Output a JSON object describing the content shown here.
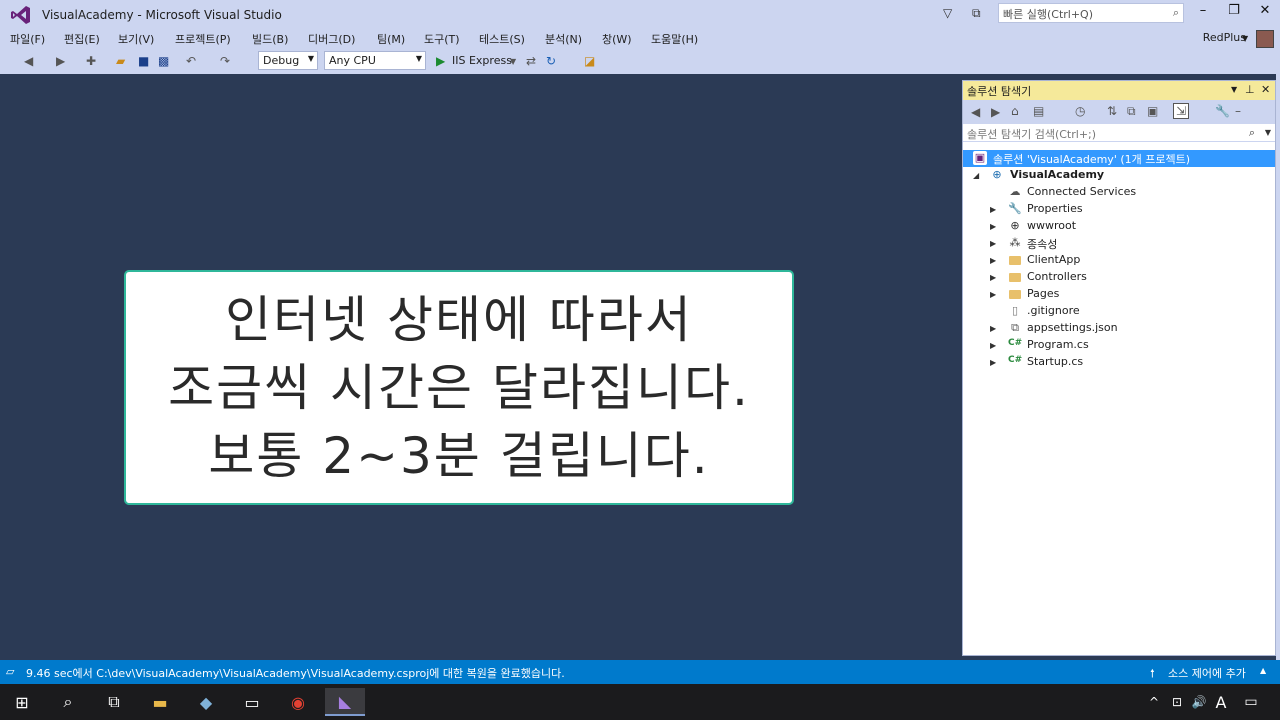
{
  "window": {
    "title": "VisualAcademy - Microsoft Visual Studio"
  },
  "quick_launch": {
    "placeholder": "빠른 실행(Ctrl+Q)"
  },
  "menu": [
    "파일(F)",
    "편집(E)",
    "보기(V)",
    "프로젝트(P)",
    "빌드(B)",
    "디버그(D)",
    "팀(M)",
    "도구(T)",
    "테스트(S)",
    "분석(N)",
    "창(W)",
    "도움말(H)"
  ],
  "user": {
    "name": "RedPlus"
  },
  "toolbar": {
    "config": "Debug",
    "platform": "Any CPU",
    "run_label": "IIS Express"
  },
  "overlay": {
    "lines": [
      "인터넷 상태에 따라서",
      "조금씩 시간은 달라집니다.",
      "보통 2~3분 걸립니다."
    ]
  },
  "solution_explorer": {
    "title": "솔루션 탐색기",
    "search_placeholder": "솔루션 탐색기 검색(Ctrl+;)",
    "solution": "솔루션 'VisualAcademy' (1개 프로젝트)",
    "project": "VisualAcademy",
    "items": [
      {
        "label": "Connected Services",
        "icon": "connected-services-icon",
        "expandable": false
      },
      {
        "label": "Properties",
        "icon": "wrench-icon",
        "expandable": true
      },
      {
        "label": "wwwroot",
        "icon": "globe-icon",
        "expandable": true
      },
      {
        "label": "종속성",
        "icon": "dependencies-icon",
        "expandable": true
      },
      {
        "label": "ClientApp",
        "icon": "folder-icon",
        "expandable": true
      },
      {
        "label": "Controllers",
        "icon": "folder-icon",
        "expandable": true
      },
      {
        "label": "Pages",
        "icon": "folder-icon",
        "expandable": true
      },
      {
        "label": ".gitignore",
        "icon": "file-icon",
        "expandable": false
      },
      {
        "label": "appsettings.json",
        "icon": "json-file-icon",
        "expandable": true
      },
      {
        "label": "Program.cs",
        "icon": "csharp-file-icon",
        "expandable": true
      },
      {
        "label": "Startup.cs",
        "icon": "csharp-file-icon",
        "expandable": true
      }
    ]
  },
  "status": {
    "message": "9.46 sec에서 C:\\dev\\VisualAcademy\\VisualAcademy\\VisualAcademy.csproj에 대한 복원을 완료했습니다.",
    "source_control": "소스 제어에 추가"
  }
}
